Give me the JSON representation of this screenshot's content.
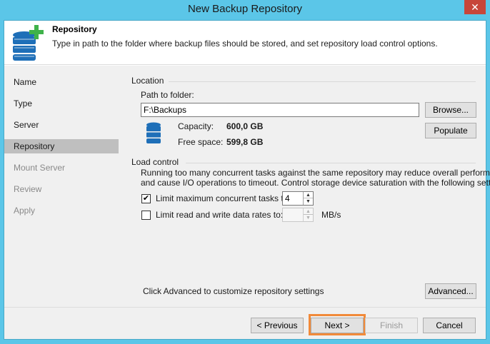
{
  "window": {
    "title": "New Backup Repository",
    "close_label": "✕"
  },
  "header": {
    "icon": "database-add-icon",
    "title": "Repository",
    "description": "Type in path to the folder where backup files should be stored, and set repository load control options."
  },
  "nav": {
    "items": [
      {
        "label": "Name"
      },
      {
        "label": "Type"
      },
      {
        "label": "Server"
      },
      {
        "label": "Repository"
      },
      {
        "label": "Mount Server"
      },
      {
        "label": "Review"
      },
      {
        "label": "Apply"
      }
    ]
  },
  "location": {
    "group_label": "Location",
    "path_label": "Path to folder:",
    "path_value": "F:\\Backups",
    "browse_label": "Browse...",
    "populate_label": "Populate",
    "capacity_label": "Capacity:",
    "capacity_value": "600,0 GB",
    "free_label": "Free space:",
    "free_value": "599,8 GB"
  },
  "load_control": {
    "group_label": "Load control",
    "description_line1": "Running too many concurrent tasks against the same repository may reduce overall performance,",
    "description_line2": "and cause I/O operations to timeout. Control storage device saturation with the following settings:",
    "limit_tasks_label": "Limit maximum concurrent tasks to:",
    "limit_tasks_checked": "✔",
    "limit_tasks_value": "4",
    "limit_rate_label": "Limit read and write data rates to:",
    "limit_rate_value": "",
    "rate_unit": "MB/s"
  },
  "advanced": {
    "hint": "Click Advanced to customize repository settings",
    "button_label": "Advanced..."
  },
  "footer": {
    "previous_label": "< Previous",
    "next_label": "Next >",
    "finish_label": "Finish",
    "cancel_label": "Cancel"
  },
  "colors": {
    "accent": "#5bc6e8",
    "highlight": "#f18a3a",
    "icon_blue": "#1e6fb8",
    "icon_green": "#3fb24a"
  }
}
